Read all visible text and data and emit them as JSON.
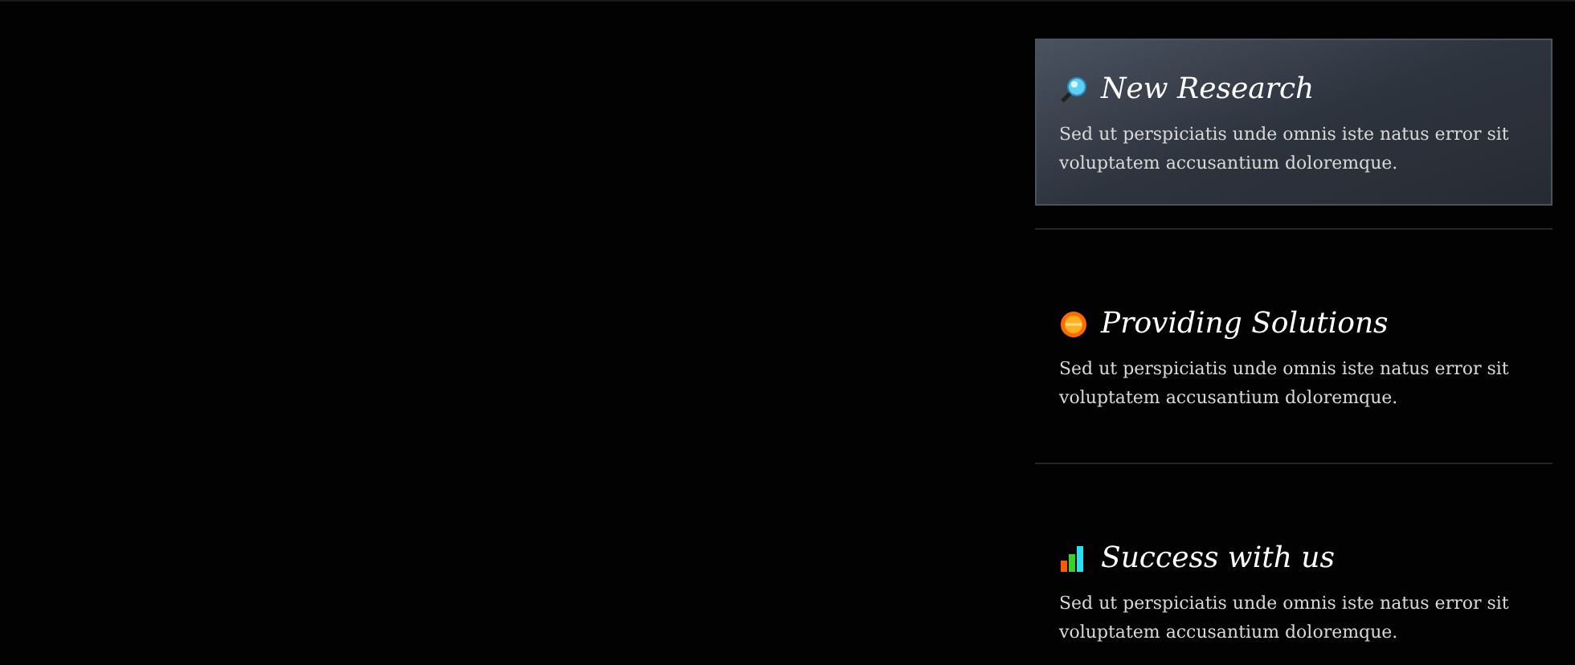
{
  "features": [
    {
      "kind": "magnifier",
      "title": "New Research",
      "text": "Sed ut perspiciatis unde omnis iste natus error sit voluptatem accusantium doloremque.",
      "selected": true
    },
    {
      "kind": "sun",
      "title": "Providing Solutions",
      "text": "Sed ut perspiciatis unde omnis iste natus error sit voluptatem accusantium doloremque.",
      "selected": false
    },
    {
      "kind": "chart",
      "title": "Success with us",
      "text": "Sed ut perspiciatis unde omnis iste natus error sit voluptatem accusantium doloremque.",
      "selected": false
    }
  ]
}
